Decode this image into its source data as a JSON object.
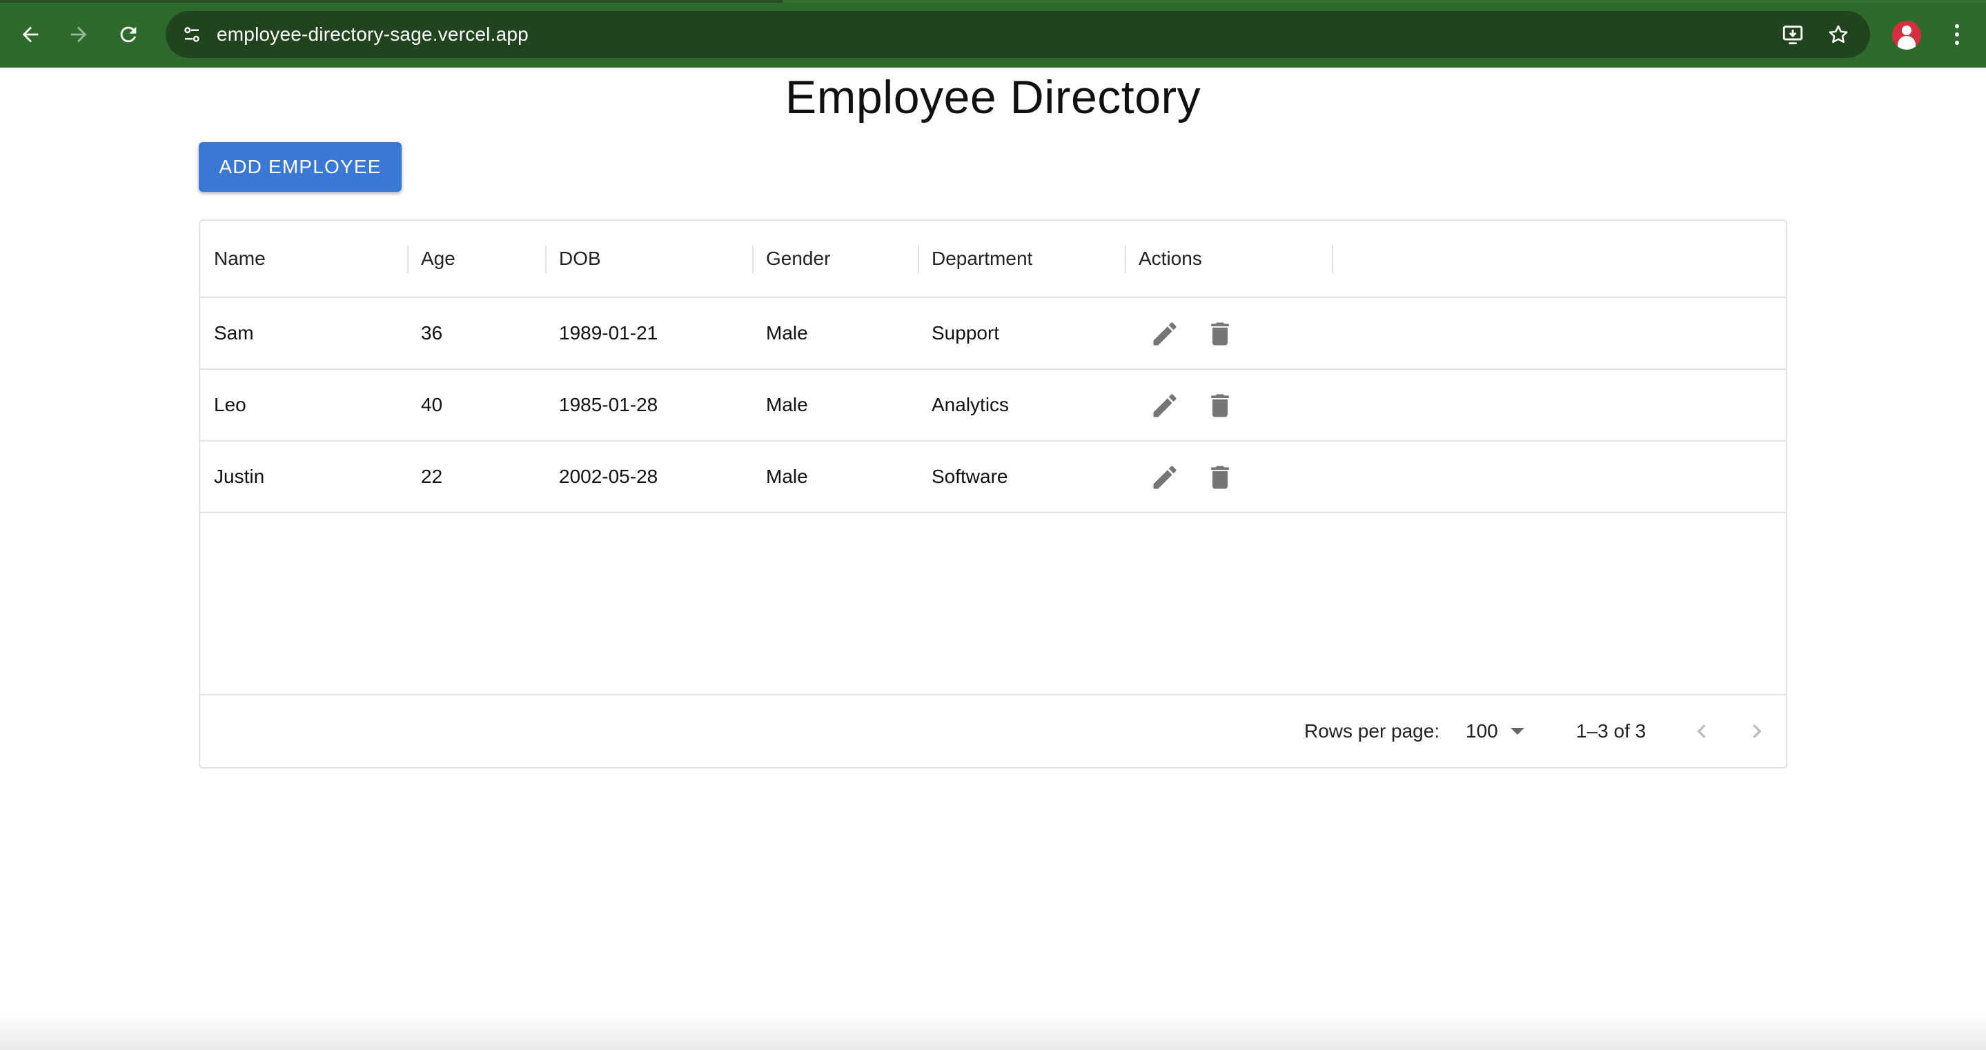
{
  "browser": {
    "url": "employee-directory-sage.vercel.app",
    "icons": {
      "back": "arrow-left-icon",
      "forward": "arrow-right-icon",
      "reload": "reload-icon",
      "site_info": "tune-icon",
      "install": "install-app-icon",
      "bookmark": "star-icon",
      "profile": "profile-avatar",
      "menu": "more-vert-icon"
    },
    "colors": {
      "toolbar": "#2f6a2d",
      "omnibox": "#21441f"
    }
  },
  "page": {
    "title": "Employee Directory",
    "add_button_label": "ADD EMPLOYEE",
    "accent_color": "#3a78d6"
  },
  "table": {
    "columns": [
      "Name",
      "Age",
      "DOB",
      "Gender",
      "Department",
      "Actions"
    ],
    "rows": [
      {
        "name": "Sam",
        "age": "36",
        "dob": "1989-01-21",
        "gender": "Male",
        "department": "Support"
      },
      {
        "name": "Leo",
        "age": "40",
        "dob": "1985-01-28",
        "gender": "Male",
        "department": "Analytics"
      },
      {
        "name": "Justin",
        "age": "22",
        "dob": "2002-05-28",
        "gender": "Male",
        "department": "Software"
      }
    ],
    "row_action_icons": [
      "edit-icon",
      "delete-icon"
    ]
  },
  "pagination": {
    "rows_per_page_label": "Rows per page:",
    "rows_per_page_value": "100",
    "range_text": "1–3 of 3",
    "prev_icon": "chevron-left-icon",
    "next_icon": "chevron-right-icon"
  }
}
